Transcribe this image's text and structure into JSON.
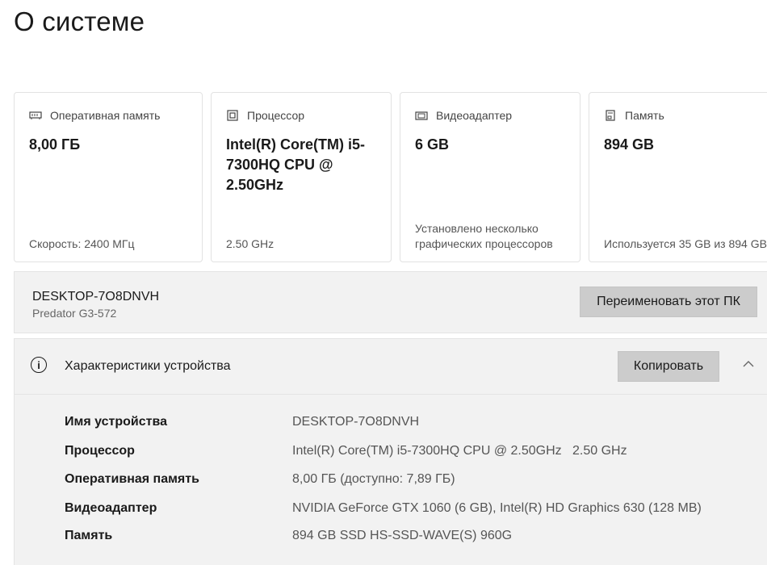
{
  "page": {
    "title": "О системе"
  },
  "cards": [
    {
      "icon": "ram-icon",
      "label": "Оперативная память",
      "value": "8,00 ГБ",
      "sub": "Скорость: 2400 МГц"
    },
    {
      "icon": "cpu-icon",
      "label": "Процессор",
      "value": "Intel(R) Core(TM) i5-7300HQ CPU @ 2.50GHz",
      "sub": "2.50 GHz"
    },
    {
      "icon": "gpu-icon",
      "label": "Видеоадаптер",
      "value": "6 GB",
      "sub": "Установлено несколько графических процессоров"
    },
    {
      "icon": "storage-icon",
      "label": "Память",
      "value": "894 GB",
      "sub": "Используется 35 GB из 894 GB"
    }
  ],
  "device": {
    "name": "DESKTOP-7O8DNVH",
    "model": "Predator G3-572",
    "rename_label": "Переименовать этот ПК"
  },
  "specs": {
    "title": "Характеристики устройства",
    "copy_label": "Копировать",
    "rows": [
      {
        "key": "Имя устройства",
        "value": "DESKTOP-7O8DNVH"
      },
      {
        "key": "Процессор",
        "value": "Intel(R) Core(TM) i5-7300HQ CPU @ 2.50GHz   2.50 GHz"
      },
      {
        "key": "Оперативная память",
        "value": "8,00 ГБ (доступно: 7,89 ГБ)"
      },
      {
        "key": "Видеоадаптер",
        "value": "NVIDIA GeForce GTX 1060 (6 GB), Intel(R) HD Graphics 630 (128 MB)"
      },
      {
        "key": "Память",
        "value": "894 GB SSD HS-SSD-WAVE(S) 960G"
      }
    ]
  }
}
